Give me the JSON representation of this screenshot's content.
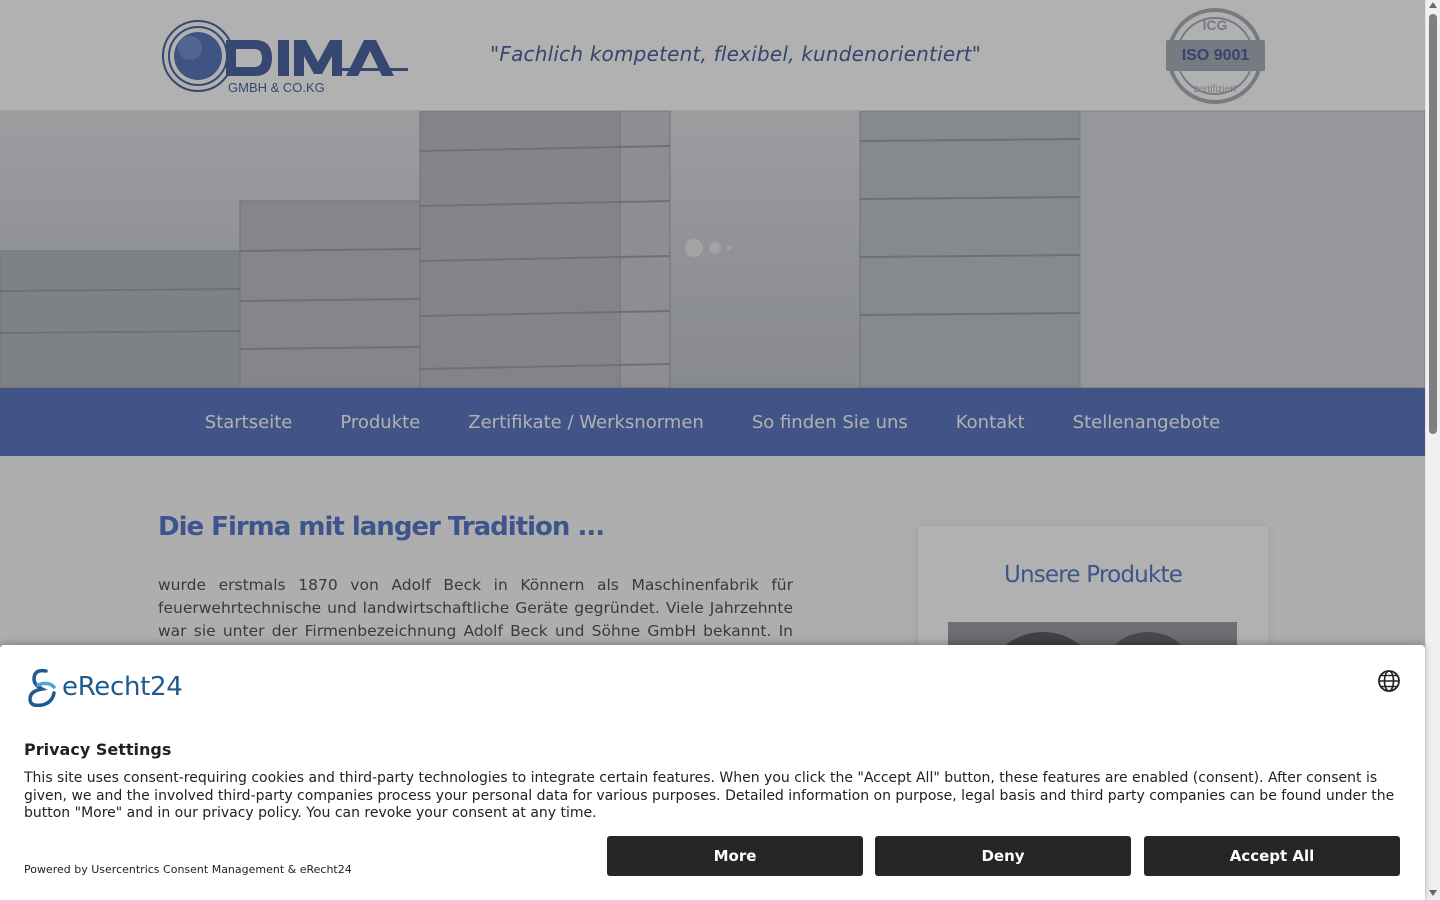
{
  "header": {
    "logo_text": "DIMA",
    "logo_sub": "GMBH & CO.KG",
    "slogan": "\"Fachlich kompetent, flexibel, kundenorientiert\"",
    "iso_badge": "ISO 9001",
    "iso_ring_top": "ICG",
    "iso_ring_bottom": "zertifiziert"
  },
  "nav": {
    "items": [
      "Startseite",
      "Produkte",
      "Zertifikate / Werksnormen",
      "So finden Sie uns",
      "Kontakt",
      "Stellenangebote"
    ]
  },
  "main": {
    "heading": "Die Firma mit langer Tradition ...",
    "paragraph": "wurde erstmals 1870 von Adolf Beck in Könnern als Maschinenfabrik für feuerwehrtechnische und landwirtschaftliche Geräte gegründet. Viele Jahrzehnte war sie unter der Firmenbezeichnung Adolf Beck und Söhne GmbH bekannt. In den"
  },
  "sidebar": {
    "title": "Unsere Produkte"
  },
  "consent": {
    "brand": "eRecht24",
    "title": "Privacy Settings",
    "text": "This site uses consent-requiring cookies and third-party technologies to integrate certain features. When you click the \"Accept All\" button, these features are enabled (consent). After consent is given, we and the involved third-party companies process your personal data for various purposes. Detailed information on purpose, legal basis and third party companies can be found under the button \"More\" and in our privacy policy. You can revoke your consent at any time.",
    "powered_by": "Powered by Usercentrics Consent Management & eRecht24",
    "more_label": "More",
    "deny_label": "Deny",
    "accept_label": "Accept All",
    "language_icon": "globe-icon"
  },
  "colors": {
    "brand_blue": "#3e5fb8",
    "heading_blue": "#3a5fc0",
    "button_dark": "#262626"
  }
}
